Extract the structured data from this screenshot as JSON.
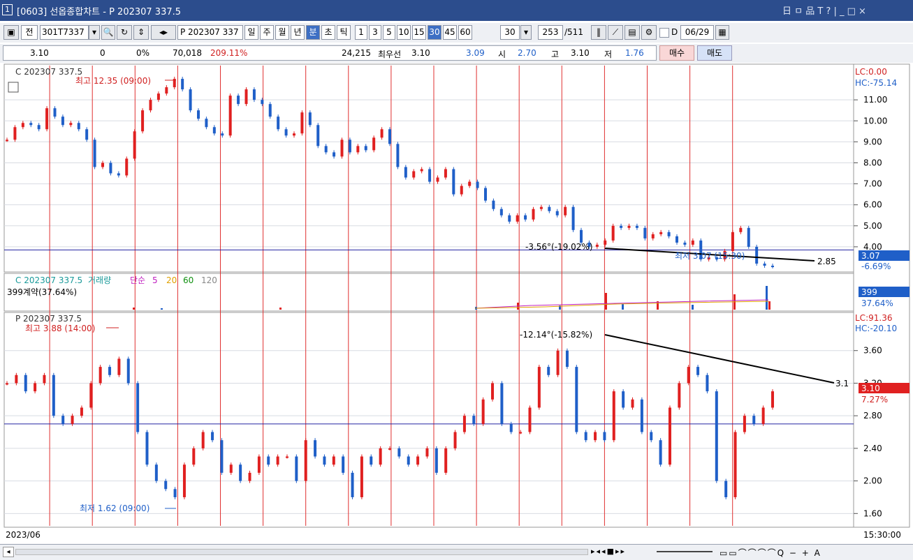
{
  "window": {
    "number": "1",
    "title": "[0603] 선옵종합차트 - P 202307 337.5",
    "controls": "日 ㅁ 品 T ? | _ □ ×"
  },
  "toolbar": {
    "type_btn": "전",
    "code": "301T7337",
    "name": "P 202307 337",
    "periods": [
      "일",
      "주",
      "월",
      "년",
      "분",
      "초",
      "틱"
    ],
    "selected_period": "분",
    "intervals": [
      "1",
      "3",
      "5",
      "10",
      "15",
      "30",
      "45",
      "60"
    ],
    "selected_interval": "30",
    "interval_value": "30",
    "count": "253",
    "total": "/511",
    "d_label": "D",
    "date": "06/29"
  },
  "quote": {
    "price": "3.10",
    "change": "0",
    "change_pct": "0%",
    "volume": "70,018",
    "volume_pct": "209.11%",
    "open_interest": "24,215",
    "best_label": "최우선",
    "best_ask": "3.10",
    "best_bid": "3.09",
    "open_label": "시",
    "open": "2.70",
    "high_label": "고",
    "high": "3.10",
    "low_label": "저",
    "low": "1.76",
    "buy": "매수",
    "sell": "매도"
  },
  "panes": {
    "call": {
      "label": "C 202307 337.5",
      "high_label": "최고 12.35 (09:00)",
      "low_label": "최저 3.07 (15:30)",
      "trend_label": "-3.56°(-19.02%)",
      "trend_end": "2.85",
      "lc": "LC:0.00",
      "hc": "HC:-75.14",
      "last": "3.07",
      "last_pct": "-6.69%",
      "yticks": [
        "11.00",
        "10.00",
        "9.00",
        "8.00",
        "7.00",
        "6.00",
        "5.00",
        "4.00"
      ]
    },
    "volume": {
      "label": "C 202307 337.5",
      "vol_label": "거래량",
      "ma_label": "단순",
      "mas": [
        "5",
        "20",
        "60",
        "120"
      ],
      "contracts": "399계약(37.64%)",
      "last": "399",
      "last_pct": "37.64%"
    },
    "put": {
      "label": "P 202307 337.5",
      "high_label": "최고 3.88 (14:00)",
      "low_label": "최저 1.62 (09:00)",
      "trend_label": "-12.14°(-15.82%)",
      "trend_end": "3.1",
      "lc": "LC:91.36",
      "hc": "HC:-20.10",
      "last": "3.10",
      "last_pct": "7.27%",
      "yticks": [
        "3.60",
        "3.20",
        "2.80",
        "2.40",
        "2.00",
        "1.60"
      ]
    }
  },
  "xaxis": {
    "start_date": "2023/06",
    "last_time": "15:30:00"
  },
  "colors": {
    "up": "#e02020",
    "down": "#1f5fc8",
    "session_line": "#e03030",
    "ref_line": "#2020a0",
    "title_bg": "#2c4d8d"
  },
  "chart_data": [
    {
      "type": "candlestick",
      "title": "C 202307 337.5",
      "ylim": [
        3,
        12.5
      ],
      "sessions": 20,
      "values": [
        9.1,
        9.7,
        9.9,
        9.8,
        9.6,
        10.6,
        10.2,
        9.8,
        9.9,
        9.6,
        9.1,
        7.8,
        8.0,
        7.5,
        7.4,
        8.2,
        9.5,
        10.5,
        11.0,
        11.3,
        11.6,
        12.0,
        11.5,
        10.5,
        10.1,
        9.7,
        9.4,
        9.3,
        11.2,
        10.8,
        11.5,
        11.0,
        10.8,
        10.2,
        9.6,
        9.3,
        9.4,
        10.4,
        9.8,
        8.8,
        8.5,
        8.3,
        9.1,
        8.5,
        8.8,
        8.6,
        9.2,
        9.6,
        8.9,
        7.8,
        7.3,
        7.6,
        7.7,
        7.1,
        7.3,
        7.7,
        6.5,
        6.9,
        7.1,
        6.8,
        6.2,
        5.8,
        5.5,
        5.2,
        5.5,
        5.3,
        5.8,
        5.9,
        5.7,
        5.5,
        5.9,
        4.8,
        4.2,
        4.0,
        4.1,
        4.3,
        5.0,
        4.9,
        5.0,
        4.9,
        4.4,
        4.6,
        4.7,
        4.5,
        4.2,
        4.1,
        4.3,
        3.4,
        3.5,
        3.4,
        3.8,
        4.7,
        4.9,
        4.0,
        3.2,
        3.1,
        3.07
      ]
    },
    {
      "type": "bar",
      "title": "C 202307 337.5 거래량",
      "values": [
        399
      ]
    },
    {
      "type": "candlestick",
      "title": "P 202307 337.5",
      "ylim": [
        1.5,
        4.0
      ],
      "sessions": 20,
      "values": [
        3.2,
        3.3,
        3.1,
        3.2,
        3.3,
        2.8,
        2.7,
        2.8,
        2.9,
        3.2,
        3.4,
        3.3,
        3.5,
        3.2,
        2.6,
        2.2,
        2.0,
        1.9,
        1.8,
        2.2,
        2.4,
        2.6,
        2.5,
        2.1,
        2.2,
        2.0,
        2.1,
        2.3,
        2.2,
        2.3,
        2.3,
        2.0,
        2.5,
        2.3,
        2.2,
        2.3,
        2.1,
        1.8,
        2.3,
        2.2,
        2.4,
        2.4,
        2.3,
        2.2,
        2.3,
        2.4,
        2.1,
        2.4,
        2.6,
        2.8,
        2.7,
        3.0,
        3.2,
        2.7,
        2.6,
        2.6,
        2.9,
        3.4,
        3.3,
        3.6,
        3.4,
        2.6,
        2.5,
        2.6,
        2.5,
        3.1,
        2.9,
        3.0,
        2.6,
        2.5,
        2.2,
        2.9,
        3.2,
        3.4,
        3.3,
        3.1,
        2.0,
        1.8,
        2.6,
        2.8,
        2.7,
        2.9,
        3.1
      ]
    }
  ]
}
